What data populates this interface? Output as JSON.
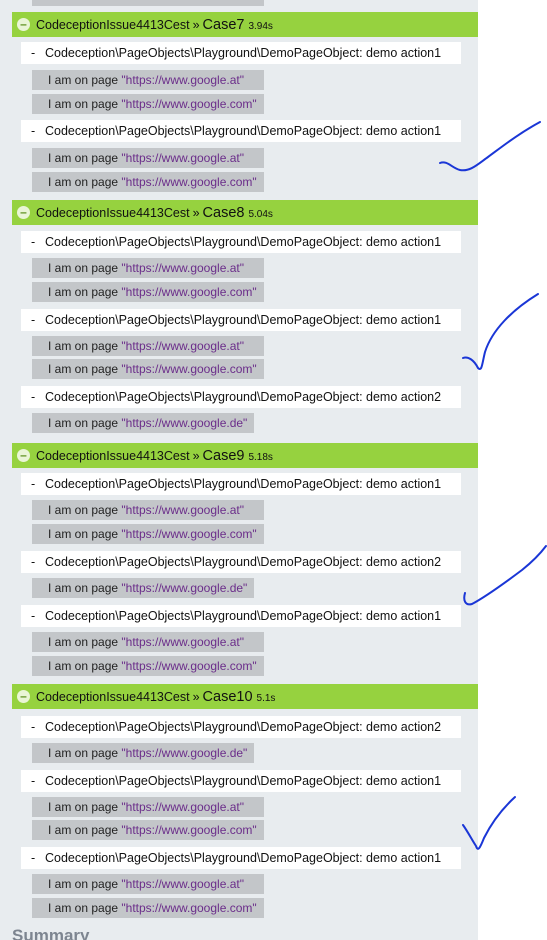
{
  "cases": [
    {
      "class_name": "CodeceptionIssue4413Cest",
      "separator": "»",
      "case_name": "Case7",
      "duration": "3.94s",
      "actions": [
        {
          "dash": "-",
          "text": "Codeception\\PageObjects\\Playground\\DemoPageObject: demo action1",
          "steps": [
            {
              "prefix": "I am on page ",
              "url": "\"https://www.google.at\""
            },
            {
              "prefix": "I am on page ",
              "url": "\"https://www.google.com\""
            }
          ]
        },
        {
          "dash": "-",
          "text": "Codeception\\PageObjects\\Playground\\DemoPageObject: demo action1",
          "steps": [
            {
              "prefix": "I am on page ",
              "url": "\"https://www.google.at\""
            },
            {
              "prefix": "I am on page ",
              "url": "\"https://www.google.com\""
            }
          ]
        }
      ]
    },
    {
      "class_name": "CodeceptionIssue4413Cest",
      "separator": "»",
      "case_name": "Case8",
      "duration": "5.04s",
      "actions": [
        {
          "dash": "-",
          "text": "Codeception\\PageObjects\\Playground\\DemoPageObject: demo action1",
          "steps": [
            {
              "prefix": "I am on page ",
              "url": "\"https://www.google.at\""
            },
            {
              "prefix": "I am on page ",
              "url": "\"https://www.google.com\""
            }
          ]
        },
        {
          "dash": "-",
          "text": "Codeception\\PageObjects\\Playground\\DemoPageObject: demo action1",
          "steps": [
            {
              "prefix": "I am on page ",
              "url": "\"https://www.google.at\""
            },
            {
              "prefix": "I am on page ",
              "url": "\"https://www.google.com\""
            }
          ]
        },
        {
          "dash": "-",
          "text": "Codeception\\PageObjects\\Playground\\DemoPageObject: demo action2",
          "steps": [
            {
              "prefix": "I am on page ",
              "url": "\"https://www.google.de\""
            }
          ]
        }
      ]
    },
    {
      "class_name": "CodeceptionIssue4413Cest",
      "separator": "»",
      "case_name": "Case9",
      "duration": "5.18s",
      "actions": [
        {
          "dash": "-",
          "text": "Codeception\\PageObjects\\Playground\\DemoPageObject: demo action1",
          "steps": [
            {
              "prefix": "I am on page ",
              "url": "\"https://www.google.at\""
            },
            {
              "prefix": "I am on page ",
              "url": "\"https://www.google.com\""
            }
          ]
        },
        {
          "dash": "-",
          "text": "Codeception\\PageObjects\\Playground\\DemoPageObject: demo action2",
          "steps": [
            {
              "prefix": "I am on page ",
              "url": "\"https://www.google.de\""
            }
          ]
        },
        {
          "dash": "-",
          "text": "Codeception\\PageObjects\\Playground\\DemoPageObject: demo action1",
          "steps": [
            {
              "prefix": "I am on page ",
              "url": "\"https://www.google.at\""
            },
            {
              "prefix": "I am on page ",
              "url": "\"https://www.google.com\""
            }
          ]
        }
      ]
    },
    {
      "class_name": "CodeceptionIssue4413Cest",
      "separator": "»",
      "case_name": "Case10",
      "duration": "5.1s",
      "actions": [
        {
          "dash": "-",
          "text": "Codeception\\PageObjects\\Playground\\DemoPageObject: demo action2",
          "steps": [
            {
              "prefix": "I am on page ",
              "url": "\"https://www.google.de\""
            }
          ]
        },
        {
          "dash": "-",
          "text": "Codeception\\PageObjects\\Playground\\DemoPageObject: demo action1",
          "steps": [
            {
              "prefix": "I am on page ",
              "url": "\"https://www.google.at\""
            },
            {
              "prefix": "I am on page ",
              "url": "\"https://www.google.com\""
            }
          ]
        },
        {
          "dash": "-",
          "text": "Codeception\\PageObjects\\Playground\\DemoPageObject: demo action1",
          "steps": [
            {
              "prefix": "I am on page ",
              "url": "\"https://www.google.at\""
            },
            {
              "prefix": "I am on page ",
              "url": "\"https://www.google.com\""
            }
          ]
        }
      ]
    }
  ],
  "toggle_symbol": "–",
  "summary_label": "Summary",
  "colors": {
    "header_green": "#96d23f",
    "panel_bg": "#e8ecef",
    "step_bg": "#c3c6c9",
    "url_text": "#6b2d8a",
    "pen_stroke": "#1a36d6"
  },
  "annotations": [
    "checkmark-icon",
    "checkmark-icon",
    "checkmark-icon",
    "checkmark-icon"
  ]
}
